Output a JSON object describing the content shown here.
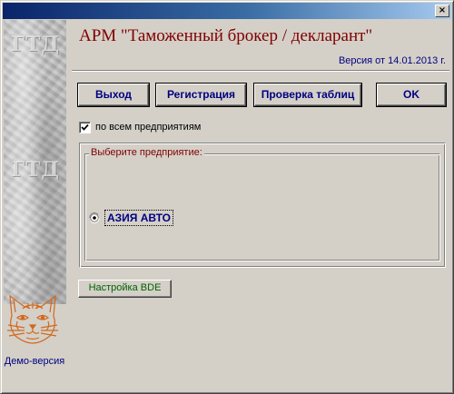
{
  "window": {
    "close_glyph": "×",
    "title_bar_colors": [
      "#0a246a",
      "#a6caf0"
    ]
  },
  "sidebar": {
    "watermark_text": "ГТД",
    "logo_icon": "cat-face-icon",
    "demo_label": "Демо-версия"
  },
  "header": {
    "title": "АРМ \"Таможенный брокер / декларант\"",
    "version": "Версия от 14.01.2013 г."
  },
  "toolbar": {
    "exit_label": "Выход",
    "register_label": "Регистрация",
    "check_tables_label": "Проверка таблиц",
    "ok_label": "OK"
  },
  "options": {
    "all_enterprises_label": "по всем предприятиям",
    "all_enterprises_checked": true
  },
  "enterprise_group": {
    "legend": "Выберите предприятие:",
    "options": [
      {
        "label": "АЗИЯ АВТО",
        "selected": true
      }
    ]
  },
  "footer": {
    "bde_settings_label": "Настройка BDE"
  },
  "colors": {
    "face": "#d4d0c8",
    "title_text": "#800000",
    "button_text": "#000080",
    "bde_text": "#006400",
    "legend_text": "#800000"
  }
}
